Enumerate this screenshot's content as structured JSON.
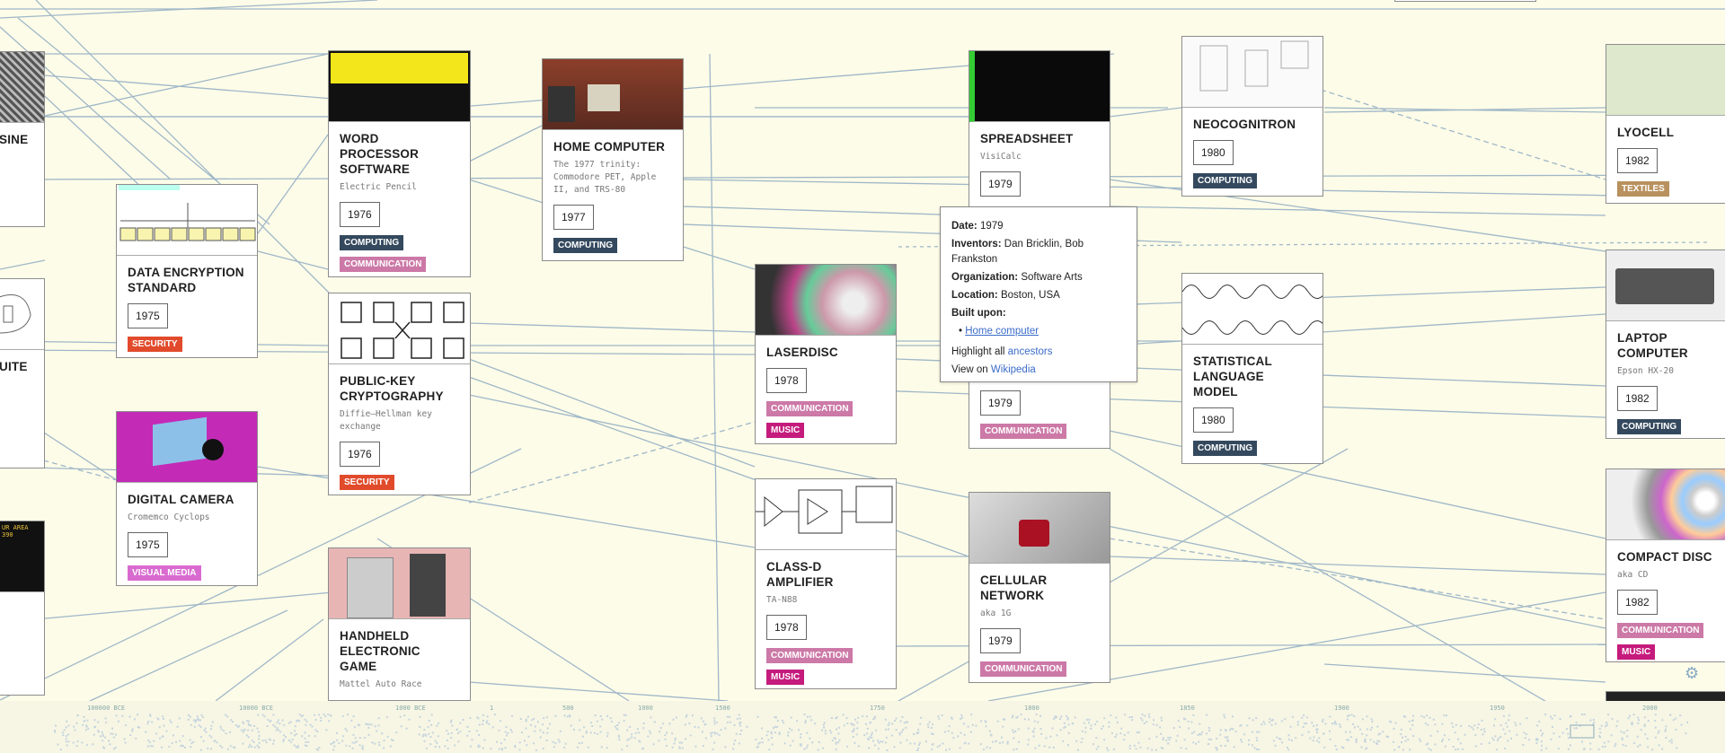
{
  "cards": {
    "sine": {
      "title": "SINE"
    },
    "suite": {
      "title": "UITE"
    },
    "word": {
      "title": "WORD PROCESSOR SOFTWARE",
      "sub": "Electric Pencil",
      "year": "1976",
      "tags": [
        "COMPUTING",
        "COMMUNICATION"
      ]
    },
    "home": {
      "title": "HOME COMPUTER",
      "sub": "The 1977 trinity: Commodore PET, Apple II, and TRS-80",
      "year": "1977",
      "tags": [
        "COMPUTING"
      ]
    },
    "spreadsheet": {
      "title": "SPREADSHEET",
      "sub": "VisiCalc",
      "year": "1979"
    },
    "neocognitron": {
      "title": "NEOCOGNITRON",
      "year": "1980",
      "tags": [
        "COMPUTING"
      ]
    },
    "lyocell": {
      "title": "LYOCELL",
      "year": "1982",
      "tags": [
        "TEXTILES"
      ]
    },
    "des": {
      "title": "DATA ENCRYPTION STANDARD",
      "year": "1975",
      "tags": [
        "SECURITY"
      ]
    },
    "pkc": {
      "title": "PUBLIC-KEY CRYPTOGRAPHY",
      "sub": "Diffie–Hellman key exchange",
      "year": "1976",
      "tags": [
        "SECURITY"
      ]
    },
    "laserdisc": {
      "title": "LASERDISC",
      "year": "1978",
      "tags": [
        "COMMUNICATION",
        "MUSIC"
      ]
    },
    "hidden1979": {
      "year": "1979",
      "tags": [
        "COMMUNICATION"
      ]
    },
    "slm": {
      "title": "STATISTICAL LANGUAGE MODEL",
      "year": "1980",
      "tags": [
        "COMPUTING"
      ]
    },
    "laptop": {
      "title": "LAPTOP COMPUTER",
      "sub": "Epson HX-20",
      "year": "1982",
      "tags": [
        "COMPUTING"
      ]
    },
    "camera": {
      "title": "DIGITAL CAMERA",
      "sub": "Cromemco Cyclops",
      "year": "1975",
      "tags": [
        "VISUAL MEDIA"
      ]
    },
    "classd": {
      "title": "CLASS-D AMPLIFIER",
      "sub": "TA-N88",
      "year": "1978",
      "tags": [
        "COMMUNICATION",
        "MUSIC"
      ]
    },
    "cellular": {
      "title": "CELLULAR NETWORK",
      "sub": "aka 1G",
      "year": "1979",
      "tags": [
        "COMMUNICATION"
      ]
    },
    "cd": {
      "title": "COMPACT DISC",
      "sub": "aka CD",
      "year": "1982",
      "tags": [
        "COMMUNICATION",
        "MUSIC"
      ]
    },
    "handheld": {
      "title": "HANDHELD ELECTRONIC GAME",
      "sub": "Mattel Auto Race"
    }
  },
  "popup": {
    "date_label": "Date:",
    "date": "1979",
    "inventors_label": "Inventors:",
    "inventors": "Dan Bricklin, Bob Frankston",
    "org_label": "Organization:",
    "org": "Software Arts",
    "location_label": "Location:",
    "location": "Boston, USA",
    "built_label": "Built upon:",
    "built_item": "Home computer",
    "highlight_text": "Highlight all",
    "highlight_link": "ancestors",
    "view_text": "View on",
    "view_link": "Wikipedia"
  },
  "timeline": {
    "ticks": [
      "100000 BCE",
      "10000 BCE",
      "1000 BCE",
      "1",
      "500",
      "1000",
      "1500",
      "1750",
      "1800",
      "1850",
      "1900",
      "1950",
      "2000"
    ]
  },
  "colors": {
    "background": "#fdfce8",
    "edge": "#9fb7c8",
    "computing": "#34495e",
    "communication": "#cc79a7",
    "security": "#e14b2c",
    "music": "#c51b7d",
    "visual_media": "#d96bd0",
    "textiles": "#b8915e"
  },
  "icons": {
    "settings": "gear-icon"
  }
}
